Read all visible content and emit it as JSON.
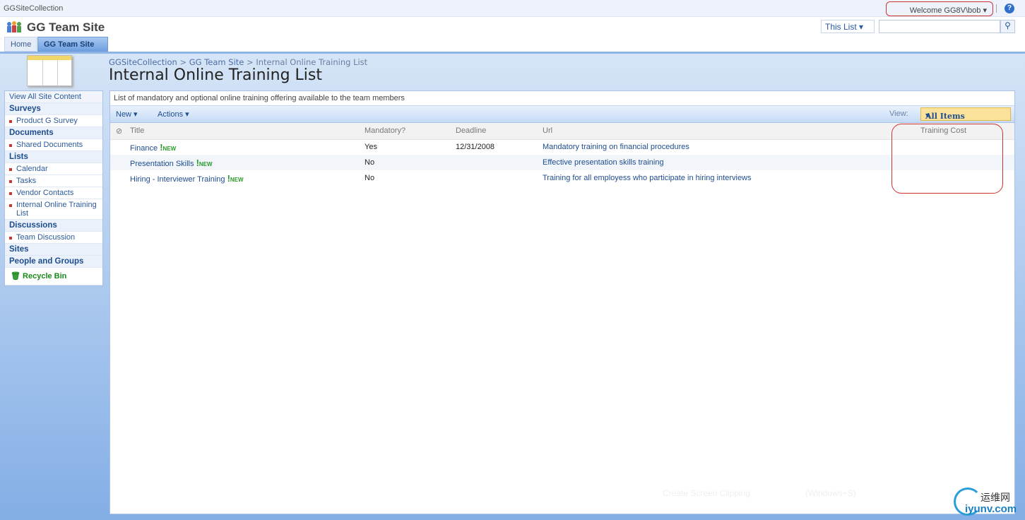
{
  "topbar": {
    "collection": "GGSiteCollection",
    "welcome": "Welcome GG8V\\bob ▾",
    "help": "?"
  },
  "header": {
    "site_title": "GG Team Site",
    "scope": "This List  ▾",
    "search_placeholder": "",
    "search_icon": "⚲"
  },
  "tabs": [
    {
      "label": "Home"
    },
    {
      "label": "GG Team Site"
    }
  ],
  "breadcrumb": {
    "items": [
      "GGSiteCollection",
      "GG Team Site",
      "Internal Online Training List"
    ],
    "sep": " > "
  },
  "page_title": "Internal Online Training List",
  "nav": {
    "view_all": "View All Site Content",
    "sections": [
      {
        "head": "Surveys",
        "items": [
          "Product G Survey"
        ]
      },
      {
        "head": "Documents",
        "items": [
          "Shared Documents"
        ]
      },
      {
        "head": "Lists",
        "items": [
          "Calendar",
          "Tasks",
          "Vendor Contacts",
          "Internal Online Training List"
        ]
      },
      {
        "head": "Discussions",
        "items": [
          "Team Discussion"
        ]
      },
      {
        "head": "Sites",
        "items": []
      },
      {
        "head": "People and Groups",
        "items": []
      }
    ],
    "recycle": "Recycle Bin"
  },
  "list": {
    "description": "List of mandatory and optional online training offering available to the team members",
    "toolbar": {
      "new": "New  ▾",
      "actions": "Actions ▾",
      "view_label": "View:",
      "view_value": "All Items"
    },
    "columns": [
      "Title",
      "Mandatory?",
      "Deadline",
      "Url",
      "Training Cost"
    ],
    "new_badge": "NEW",
    "rows": [
      {
        "title": "Finance",
        "mandatory": "Yes",
        "deadline": "12/31/2008",
        "url": "Mandatory training on financial procedures",
        "cost": ""
      },
      {
        "title": "Presentation Skills",
        "mandatory": "No",
        "deadline": "",
        "url": "Effective presentation skills training",
        "cost": ""
      },
      {
        "title": "Hiring - Interviewer Training",
        "mandatory": "No",
        "deadline": "",
        "url": "Training for all employess who participate in hiring interviews",
        "cost": ""
      }
    ]
  },
  "overlay": {
    "clip": "Create Screen Clipping",
    "shortcut": "(Windows+S)"
  },
  "watermark": {
    "cn": "运维网",
    "en": "iyunv.com"
  }
}
